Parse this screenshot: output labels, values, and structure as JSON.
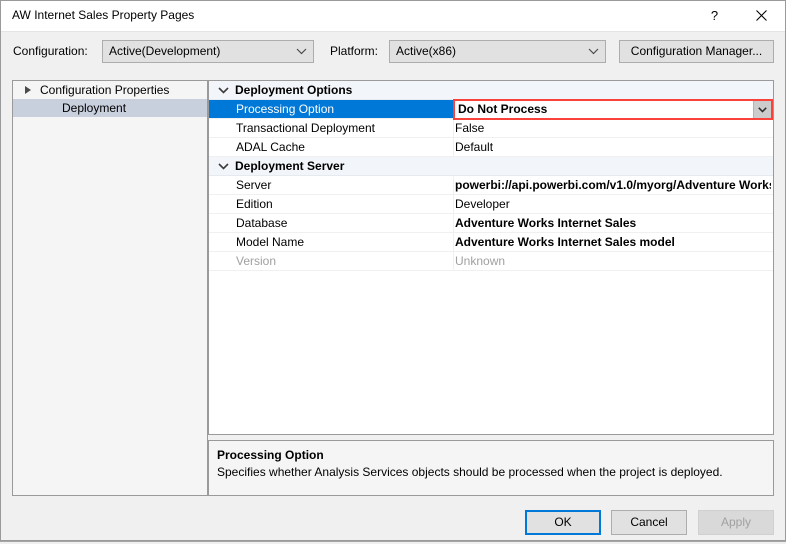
{
  "window": {
    "title": "AW Internet Sales Property Pages",
    "help_button": "?",
    "close_button": "✕"
  },
  "config_bar": {
    "configuration_label": "Configuration:",
    "configuration_value": "Active(Development)",
    "platform_label": "Platform:",
    "platform_value": "Active(x86)",
    "configuration_manager_button": "Configuration Manager..."
  },
  "tree": {
    "root_label": "Configuration Properties",
    "child_label": "Deployment"
  },
  "grid": {
    "categories": [
      {
        "name": "Deployment Options",
        "rows": [
          {
            "name": "Processing Option",
            "value": "Do Not Process",
            "selected": true,
            "bold": true,
            "editor": true,
            "disabled": false
          },
          {
            "name": "Transactional Deployment",
            "value": "False",
            "selected": false,
            "bold": false,
            "editor": false,
            "disabled": false
          },
          {
            "name": "ADAL Cache",
            "value": "Default",
            "selected": false,
            "bold": false,
            "editor": false,
            "disabled": false
          }
        ]
      },
      {
        "name": "Deployment Server",
        "rows": [
          {
            "name": "Server",
            "value": "powerbi://api.powerbi.com/v1.0/myorg/Adventure Works",
            "selected": false,
            "bold": true,
            "editor": false,
            "disabled": false
          },
          {
            "name": "Edition",
            "value": "Developer",
            "selected": false,
            "bold": false,
            "editor": false,
            "disabled": false
          },
          {
            "name": "Database",
            "value": "Adventure Works Internet Sales",
            "selected": false,
            "bold": true,
            "editor": false,
            "disabled": false
          },
          {
            "name": "Model Name",
            "value": "Adventure Works Internet Sales model",
            "selected": false,
            "bold": true,
            "editor": false,
            "disabled": false
          },
          {
            "name": "Version",
            "value": "Unknown",
            "selected": false,
            "bold": false,
            "editor": false,
            "disabled": true
          }
        ]
      }
    ]
  },
  "description": {
    "title": "Processing Option",
    "body": "Specifies whether Analysis Services objects should be processed when the project is deployed."
  },
  "footer": {
    "ok_label": "OK",
    "cancel_label": "Cancel",
    "apply_label": "Apply"
  },
  "colors": {
    "selection_blue": "#0078D7",
    "highlight_red": "#F9423A",
    "category_row": "#F2F5F9",
    "tree_selection": "#C8CFDD"
  }
}
